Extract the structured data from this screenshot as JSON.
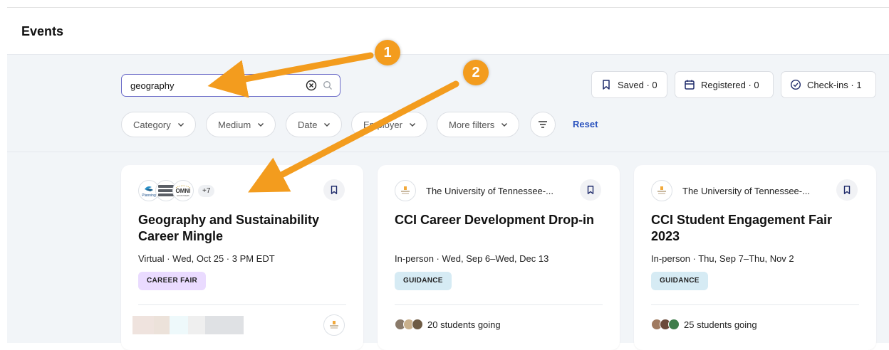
{
  "page": {
    "title": "Events"
  },
  "search": {
    "value": "geography",
    "placeholder": ""
  },
  "counters": [
    {
      "label": "Saved · 0",
      "icon": "bookmark-icon"
    },
    {
      "label": "Registered · 0",
      "icon": "calendar-icon"
    },
    {
      "label": "Check-ins · 1",
      "icon": "check-circle-icon"
    }
  ],
  "filters": {
    "chips": [
      "Category",
      "Medium",
      "Date",
      "Employer",
      "More filters"
    ],
    "reset_label": "Reset"
  },
  "cards": [
    {
      "logos": [
        "Planning",
        "OMNI ECOSYSTEMS"
      ],
      "more_logos": "+7",
      "employer": "",
      "title": "Geography and Sustainability Career Mingle",
      "meta": "Virtual · Wed, Oct 25 · 3 PM EDT",
      "tag": "CAREER FAIR",
      "tag_color": "#eadbff",
      "going": ""
    },
    {
      "employer": "The University of Tennessee-...",
      "title": "CCI Career Development Drop-in",
      "meta": "In-person · Wed, Sep 6–Wed, Dec 13",
      "tag": "GUIDANCE",
      "tag_color": "#d6ebf4",
      "going": "20 students going"
    },
    {
      "employer": "The University of Tennessee-...",
      "title": "CCI Student Engagement Fair 2023",
      "meta": "In-person · Thu, Sep 7–Thu, Nov 2",
      "tag": "GUIDANCE",
      "tag_color": "#d6ebf4",
      "going": "25 students going"
    }
  ],
  "annotations": [
    {
      "number": "1",
      "color": "#f39c1e"
    },
    {
      "number": "2",
      "color": "#f39c1e"
    }
  ]
}
